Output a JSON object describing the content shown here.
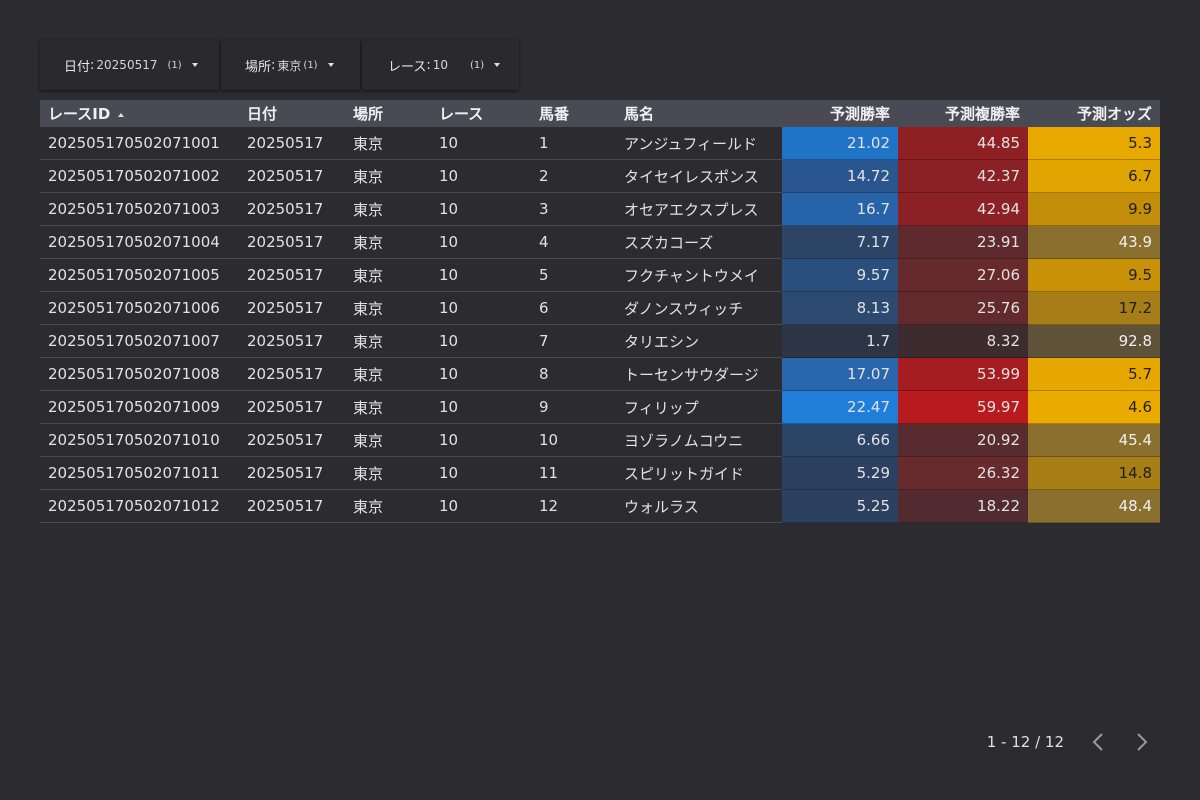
{
  "filters": [
    {
      "label": "日付",
      "sep": ":",
      "value": "20250517",
      "count": "(1)"
    },
    {
      "label": "場所",
      "sep": ":",
      "value": "東京",
      "count": "(1)"
    },
    {
      "label": "レース",
      "sep": ":",
      "value": "10",
      "count": "(1)"
    }
  ],
  "table": {
    "headers": [
      "レースID",
      "日付",
      "場所",
      "レース",
      "馬番",
      "馬名",
      "予測勝率",
      "予測複勝率",
      "予測オッズ"
    ],
    "rows": [
      [
        "202505170502071001",
        "20250517",
        "東京",
        "10",
        "1",
        "アンジュフィールド",
        "21.02",
        "44.85",
        "5.3"
      ],
      [
        "202505170502071002",
        "20250517",
        "東京",
        "10",
        "2",
        "タイセイレスポンス",
        "14.72",
        "42.37",
        "6.7"
      ],
      [
        "202505170502071003",
        "20250517",
        "東京",
        "10",
        "3",
        "オセアエクスプレス",
        "16.7",
        "42.94",
        "9.9"
      ],
      [
        "202505170502071004",
        "20250517",
        "東京",
        "10",
        "4",
        "スズカコーズ",
        "7.17",
        "23.91",
        "43.9"
      ],
      [
        "202505170502071005",
        "20250517",
        "東京",
        "10",
        "5",
        "フクチャントウメイ",
        "9.57",
        "27.06",
        "9.5"
      ],
      [
        "202505170502071006",
        "20250517",
        "東京",
        "10",
        "6",
        "ダノンスウィッチ",
        "8.13",
        "25.76",
        "17.2"
      ],
      [
        "202505170502071007",
        "20250517",
        "東京",
        "10",
        "7",
        "タリエシン",
        "1.7",
        "8.32",
        "92.8"
      ],
      [
        "202505170502071008",
        "20250517",
        "東京",
        "10",
        "8",
        "トーセンサウダージ",
        "17.07",
        "53.99",
        "5.7"
      ],
      [
        "202505170502071009",
        "20250517",
        "東京",
        "10",
        "9",
        "フィリップ",
        "22.47",
        "59.97",
        "4.6"
      ],
      [
        "202505170502071010",
        "20250517",
        "東京",
        "10",
        "10",
        "ヨゾラノムコウニ",
        "6.66",
        "20.92",
        "45.4"
      ],
      [
        "202505170502071011",
        "20250517",
        "東京",
        "10",
        "11",
        "スピリットガイド",
        "5.29",
        "26.32",
        "14.8"
      ],
      [
        "202505170502071012",
        "20250517",
        "東京",
        "10",
        "12",
        "ウォルラス",
        "5.25",
        "18.22",
        "48.4"
      ]
    ],
    "win_colors": [
      "#1f74c8",
      "#2a5690",
      "#2763a8",
      "#2c4566",
      "#2b4f7c",
      "#2c4a70",
      "#2b3546",
      "#2966ac",
      "#1e7ed9",
      "#2b4365",
      "#2c4162",
      "#2c4060"
    ],
    "place_colors": [
      "#8e1f23",
      "#8a2126",
      "#8b2125",
      "#5e2a2e",
      "#662a2d",
      "#632a2e",
      "#3d2b2f",
      "#a51d20",
      "#b81b1d",
      "#582b2f",
      "#672a2d",
      "#522b30"
    ],
    "odds_colors": [
      "#e7a800",
      "#e0a400",
      "#c28d08",
      "#8a6f2f",
      "#c99108",
      "#a67d17",
      "#5e5238",
      "#e5a700",
      "#eaab00",
      "#8a6f2f",
      "#a77f14",
      "#8a6f2f"
    ]
  },
  "pager": {
    "text": "1 - 12 / 12"
  }
}
